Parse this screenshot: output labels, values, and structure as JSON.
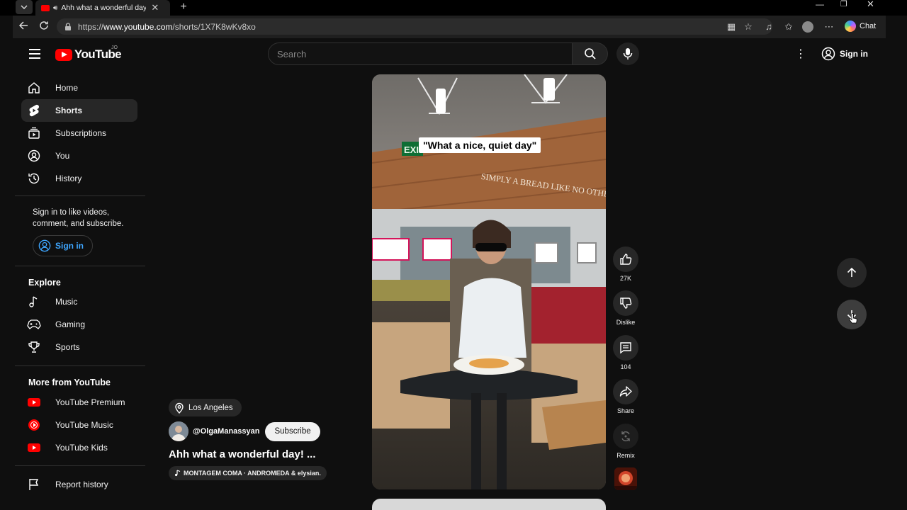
{
  "browser": {
    "tab_title": "Ahh what a wonderful day! #",
    "url_prefix": "https://",
    "url_host": "www.youtube.com",
    "url_path": "/shorts/1X7K8wKv8xo",
    "chat_label": "Chat"
  },
  "masthead": {
    "logo_text": "YouTube",
    "country_code": "JO",
    "search_placeholder": "Search",
    "sign_in_label": "Sign in"
  },
  "sidebar": {
    "items": [
      {
        "label": "Home",
        "icon": "home-icon"
      },
      {
        "label": "Shorts",
        "icon": "shorts-icon",
        "active": true
      },
      {
        "label": "Subscriptions",
        "icon": "subscriptions-icon"
      },
      {
        "label": "You",
        "icon": "you-icon"
      },
      {
        "label": "History",
        "icon": "history-icon"
      }
    ],
    "signin_prompt": "Sign in to like videos, comment, and subscribe.",
    "signin_button": "Sign in",
    "explore_title": "Explore",
    "explore_items": [
      {
        "label": "Music",
        "icon": "music-note-icon"
      },
      {
        "label": "Gaming",
        "icon": "gaming-icon"
      },
      {
        "label": "Sports",
        "icon": "trophy-icon"
      }
    ],
    "more_title": "More from YouTube",
    "more_items": [
      {
        "label": "YouTube Premium",
        "icon": "youtube-premium-icon"
      },
      {
        "label": "YouTube Music",
        "icon": "youtube-music-icon"
      },
      {
        "label": "YouTube Kids",
        "icon": "youtube-kids-icon"
      }
    ],
    "report_history": "Report history"
  },
  "short": {
    "caption": "\"What a nice, quiet day\"",
    "store_sign": "SIMPLY A BREAD LIKE NO OTHER",
    "exit_sign": "EXIT",
    "location": "Los Angeles",
    "channel": "@OlgaManassyan",
    "subscribe_label": "Subscribe",
    "title": "Ahh what a wonderful day! ...",
    "music": "MONTAGEM COMA · ANDROMEDA & elysian."
  },
  "actions": {
    "like_count": "27K",
    "dislike_label": "Dislike",
    "comment_count": "104",
    "share_label": "Share",
    "remix_label": "Remix"
  },
  "colors": {
    "accent_red": "#ff0000",
    "link_blue": "#3ea6ff",
    "bg": "#0f0f0f",
    "chip": "#272727"
  }
}
